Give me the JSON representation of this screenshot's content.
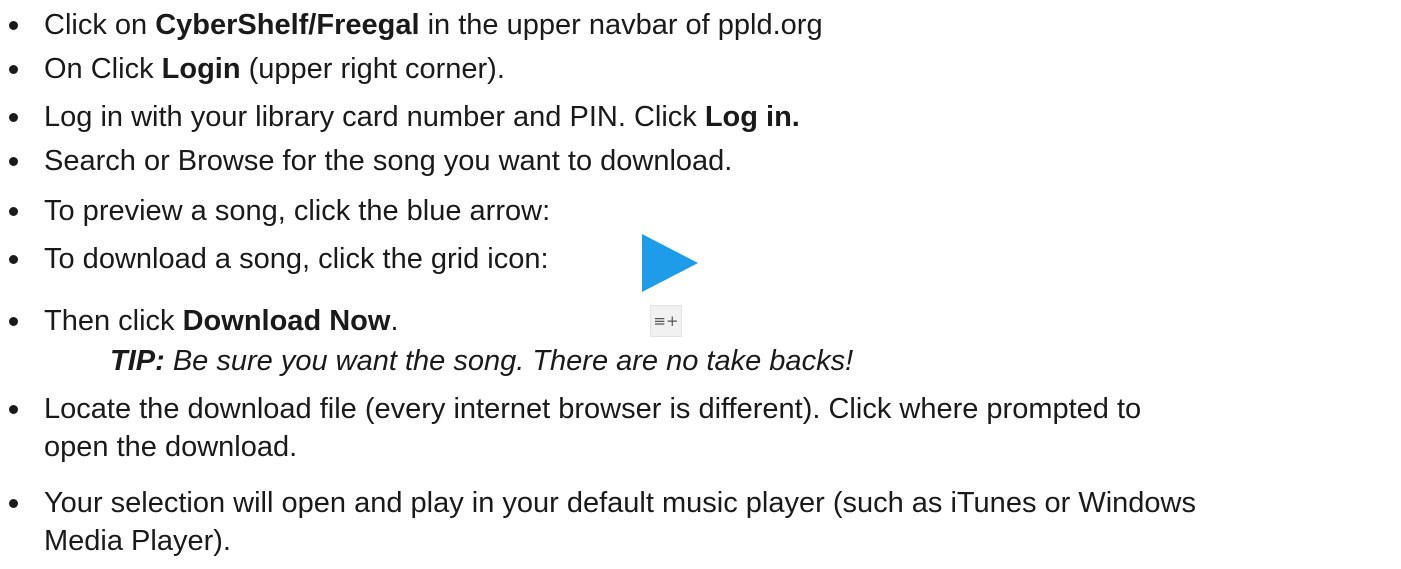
{
  "steps": [
    {
      "a": " Click on ",
      "b": "CyberShelf/Freegal",
      "c": " in the upper navbar of ppld.org"
    },
    {
      "a": "On Click ",
      "b": "Login",
      "c": " (upper right corner)."
    },
    {
      "a": "Log in with your library card number and PIN. Click ",
      "b": "Log in.",
      "c": ""
    },
    {
      "a": "Search or Browse for the song you want to download.",
      "b": "",
      "c": ""
    },
    {
      "a": "To preview a song, click the blue arrow:",
      "b": "",
      "c": ""
    },
    {
      "a": "To download a song, click the grid icon:",
      "b": "",
      "c": ""
    },
    {
      "a": "Then click ",
      "b": "Download Now",
      "c": "."
    },
    {
      "line1": "Locate the download file (every internet browser is different). Click where prompted to",
      "line2": "open the download."
    },
    {
      "line1": "Your selection will open and play in your default music player (such as iTunes or Windows",
      "line2": "Media Player)."
    }
  ],
  "tip": {
    "label": "TIP:",
    "text": " Be sure you want the song. There are no take backs!"
  },
  "icons": {
    "play": "play-arrow-icon",
    "grid": "grid-add-icon",
    "grid_glyph": "≡+",
    "play_color": "#1e9be9"
  }
}
